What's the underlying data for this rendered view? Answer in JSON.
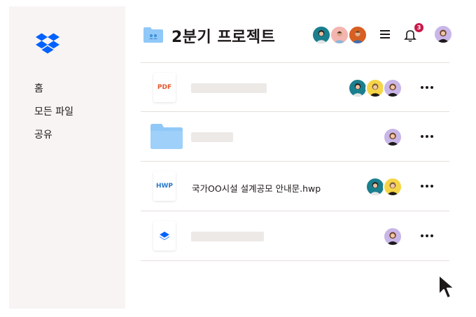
{
  "sidebar": {
    "nav": [
      "홈",
      "모든 파일",
      "공유"
    ]
  },
  "header": {
    "title": "2분기 프로젝트",
    "notification_count": "3"
  },
  "files": [
    {
      "type": "PDF",
      "name": "",
      "avatars": [
        "teal",
        "yellow",
        "lilac"
      ]
    },
    {
      "type": "folder",
      "name": "",
      "avatars": [
        "lilac"
      ]
    },
    {
      "type": "HWP",
      "name": "국가OO시설 설계공모 안내문.hwp",
      "avatars": [
        "teal",
        "yellow"
      ]
    },
    {
      "type": "dropbox",
      "name": "",
      "avatars": [
        "lilac"
      ]
    }
  ],
  "colors": {
    "sidebar_bg": "#f7f4f3",
    "brand_blue": "#0061fe",
    "folder_blue": "#90c8f8",
    "badge_red": "#c8194b",
    "pdf_orange": "#e2572a"
  }
}
